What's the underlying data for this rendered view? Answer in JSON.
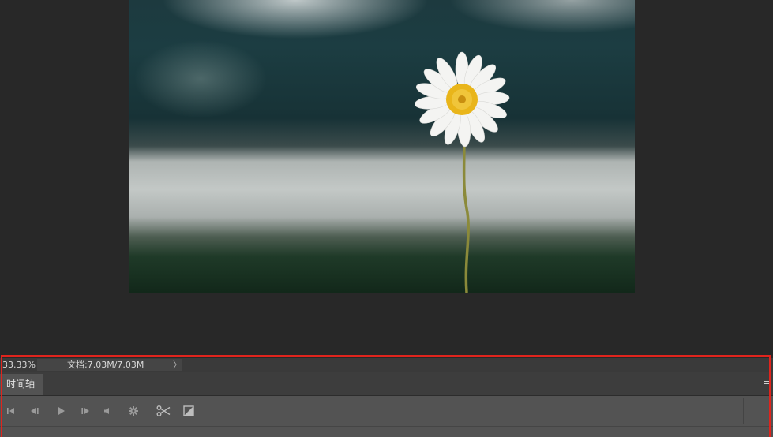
{
  "document": {
    "image_subject": "white-daisy-photo"
  },
  "status_bar": {
    "zoom": "33.33%",
    "doc_info": "文档:7.03M/7.03M",
    "arrow": "〉"
  },
  "timeline": {
    "tab_label": "时间轴",
    "controls": [
      {
        "name": "go-to-first-frame-icon"
      },
      {
        "name": "previous-frame-icon"
      },
      {
        "name": "play-icon"
      },
      {
        "name": "next-frame-icon"
      },
      {
        "name": "audio-icon"
      },
      {
        "name": "settings-gear-icon"
      },
      {
        "name": "split-scissors-icon"
      },
      {
        "name": "transition-icon"
      }
    ]
  },
  "colors": {
    "highlight": "#e0241d",
    "panel": "#535353",
    "canvas_bg": "#282828"
  }
}
